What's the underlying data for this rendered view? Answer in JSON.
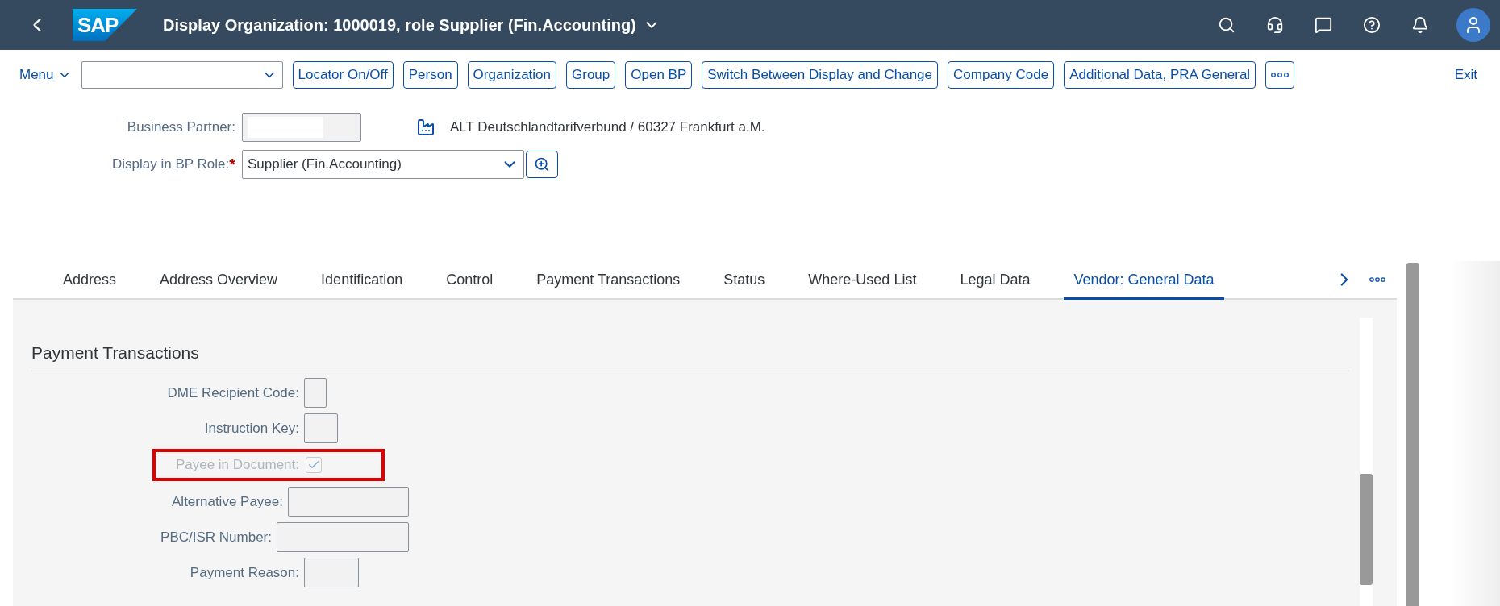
{
  "shell": {
    "logo": "SAP",
    "title": "Display Organization: 1000019, role Supplier (Fin.Accounting)"
  },
  "toolbar": {
    "menu": "Menu",
    "buttons": [
      "Locator On/Off",
      "Person",
      "Organization",
      "Group",
      "Open BP",
      "Switch Between Display and Change",
      "Company Code",
      "Additional Data, PRA General"
    ],
    "exit": "Exit"
  },
  "header_fields": {
    "business_partner_label": "Business Partner:",
    "partner_name": "ALT Deutschlandtarifverbund / 60327 Frankfurt a.M.",
    "role_label": "Display in BP Role:",
    "role_required_mark": "*",
    "role_value": "Supplier (Fin.Accounting)"
  },
  "tabs": [
    {
      "label": "Address",
      "selected": false
    },
    {
      "label": "Address Overview",
      "selected": false
    },
    {
      "label": "Identification",
      "selected": false
    },
    {
      "label": "Control",
      "selected": false
    },
    {
      "label": "Payment Transactions",
      "selected": false
    },
    {
      "label": "Status",
      "selected": false
    },
    {
      "label": "Where-Used List",
      "selected": false
    },
    {
      "label": "Legal Data",
      "selected": false
    },
    {
      "label": "Vendor: General Data",
      "selected": true
    }
  ],
  "section": {
    "title": "Payment Transactions",
    "rows": [
      {
        "label": "DME Recipient Code:",
        "kind": "input",
        "disabled": false,
        "highlighted": false
      },
      {
        "label": "Instruction Key:",
        "kind": "input",
        "disabled": false,
        "highlighted": false
      },
      {
        "label": "Payee in Document:",
        "kind": "checkbox",
        "checked": true,
        "disabled": true,
        "highlighted": true
      },
      {
        "label": "Alternative Payee:",
        "kind": "input",
        "disabled": false,
        "highlighted": false
      },
      {
        "label": "PBC/ISR Number:",
        "kind": "input",
        "disabled": false,
        "highlighted": false
      },
      {
        "label": "Payment Reason:",
        "kind": "input",
        "disabled": false,
        "highlighted": false
      }
    ]
  }
}
